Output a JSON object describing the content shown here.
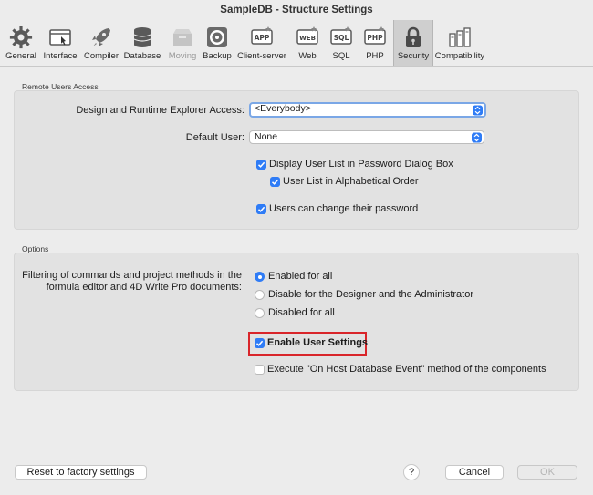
{
  "window": {
    "title": "SampleDB - Structure Settings"
  },
  "toolbar": {
    "items": [
      {
        "label": "General",
        "icon": "gear-icon"
      },
      {
        "label": "Interface",
        "icon": "interface-icon"
      },
      {
        "label": "Compiler",
        "icon": "rocket-icon"
      },
      {
        "label": "Database",
        "icon": "database-icon"
      },
      {
        "label": "Moving",
        "icon": "moving-icon"
      },
      {
        "label": "Backup",
        "icon": "backup-icon"
      },
      {
        "label": "Client-server",
        "icon": "app-server-icon",
        "badge": "APP"
      },
      {
        "label": "Web",
        "icon": "web-icon",
        "badge": "WEB"
      },
      {
        "label": "SQL",
        "icon": "sql-icon",
        "badge": "SQL"
      },
      {
        "label": "PHP",
        "icon": "php-icon",
        "badge": "PHP"
      },
      {
        "label": "Security",
        "icon": "lock-icon"
      },
      {
        "label": "Compatibility",
        "icon": "compatibility-icon"
      }
    ],
    "selected": "Security",
    "disabled": [
      "Moving"
    ]
  },
  "remote_users": {
    "title": "Remote Users Access",
    "explorer_label": "Design and Runtime Explorer Access:",
    "explorer_value": "<Everybody>",
    "default_user_label": "Default User:",
    "default_user_value": "None",
    "display_user_list": "Display User List in Password Dialog Box",
    "alphabetical": "User List in Alphabetical Order",
    "change_password": "Users can change their password"
  },
  "options": {
    "title": "Options",
    "filter_label_line1": "Filtering of commands and project methods in the",
    "filter_label_line2": "formula editor and 4D Write Pro documents:",
    "radio_enabled": "Enabled for all",
    "radio_disable_designer": "Disable for the Designer and the Administrator",
    "radio_disabled_all": "Disabled for all",
    "enable_user_settings": "Enable User Settings",
    "execute_event": "Execute \"On Host Database Event\" method of the components"
  },
  "footer": {
    "reset": "Reset to factory settings",
    "help": "?",
    "cancel": "Cancel",
    "ok": "OK"
  },
  "colors": {
    "accent": "#2f7cf6",
    "highlight": "#d9252a"
  }
}
